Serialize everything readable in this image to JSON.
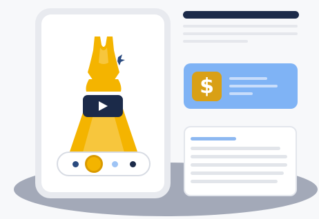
{
  "product": {
    "image_icon": "dress-icon",
    "video_icon": "play-icon",
    "swatches": [
      {
        "color": "#2a4a7f"
      },
      {
        "color": "#f0a500",
        "selected": true
      },
      {
        "color": "#9ec4f5"
      },
      {
        "color": "#1b2a49"
      }
    ]
  },
  "price_card": {
    "symbol": "$",
    "icon": "dollar-icon"
  },
  "colors": {
    "navy": "#1b2a49",
    "gold": "#f4b400",
    "blue": "#7fb3f5",
    "floor": "#a3a9b8"
  }
}
